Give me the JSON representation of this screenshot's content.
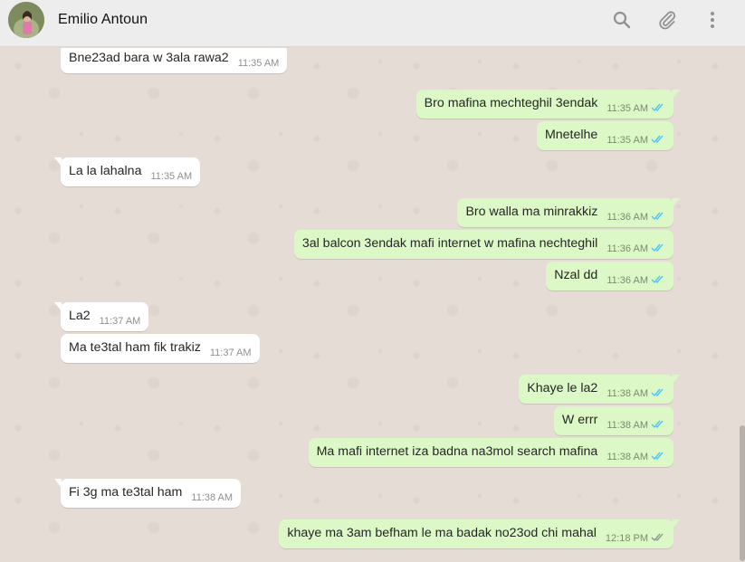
{
  "header": {
    "contact_name": "Emilio Antoun",
    "icons": [
      "search-icon",
      "attach-icon",
      "menu-icon"
    ]
  },
  "colors": {
    "incoming_bubble": "#ffffff",
    "outgoing_bubble": "#dcf8c6",
    "read_ticks": "#4fc3f7",
    "delivered_ticks": "#8c9a8c",
    "chat_background": "#e5ddd5"
  },
  "messages": [
    {
      "dir": "in",
      "text": "Bne23ad bara w 3ala rawa2",
      "time": "11:35 AM"
    },
    {
      "dir": "out",
      "text": "Bro mafina mechteghil 3endak",
      "time": "11:35 AM",
      "status": "read"
    },
    {
      "dir": "out",
      "text": "Mnetelhe",
      "time": "11:35 AM",
      "status": "read"
    },
    {
      "dir": "in",
      "text": "La la lahalna",
      "time": "11:35 AM"
    },
    {
      "dir": "out",
      "text": "Bro walla ma minrakkiz",
      "time": "11:36 AM",
      "status": "read"
    },
    {
      "dir": "out",
      "text": "3al balcon 3endak mafi internet w mafina nechteghil",
      "time": "11:36 AM",
      "status": "read"
    },
    {
      "dir": "out",
      "text": "Nzal dd",
      "time": "11:36 AM",
      "status": "read"
    },
    {
      "dir": "in",
      "text": "La2",
      "time": "11:37 AM"
    },
    {
      "dir": "in",
      "text": "Ma te3tal ham fik trakiz",
      "time": "11:37 AM"
    },
    {
      "dir": "out",
      "text": "Khaye le la2",
      "time": "11:38 AM",
      "status": "read"
    },
    {
      "dir": "out",
      "text": "W errr",
      "time": "11:38 AM",
      "status": "read"
    },
    {
      "dir": "out",
      "text": "Ma mafi internet iza badna na3mol search mafina",
      "time": "11:38 AM",
      "status": "read"
    },
    {
      "dir": "in",
      "text": "Fi 3g ma te3tal ham",
      "time": "11:38 AM"
    },
    {
      "dir": "out",
      "text": "khaye ma 3am befham le ma badak no23od chi mahal",
      "time": "12:18 PM",
      "status": "delivered"
    }
  ]
}
